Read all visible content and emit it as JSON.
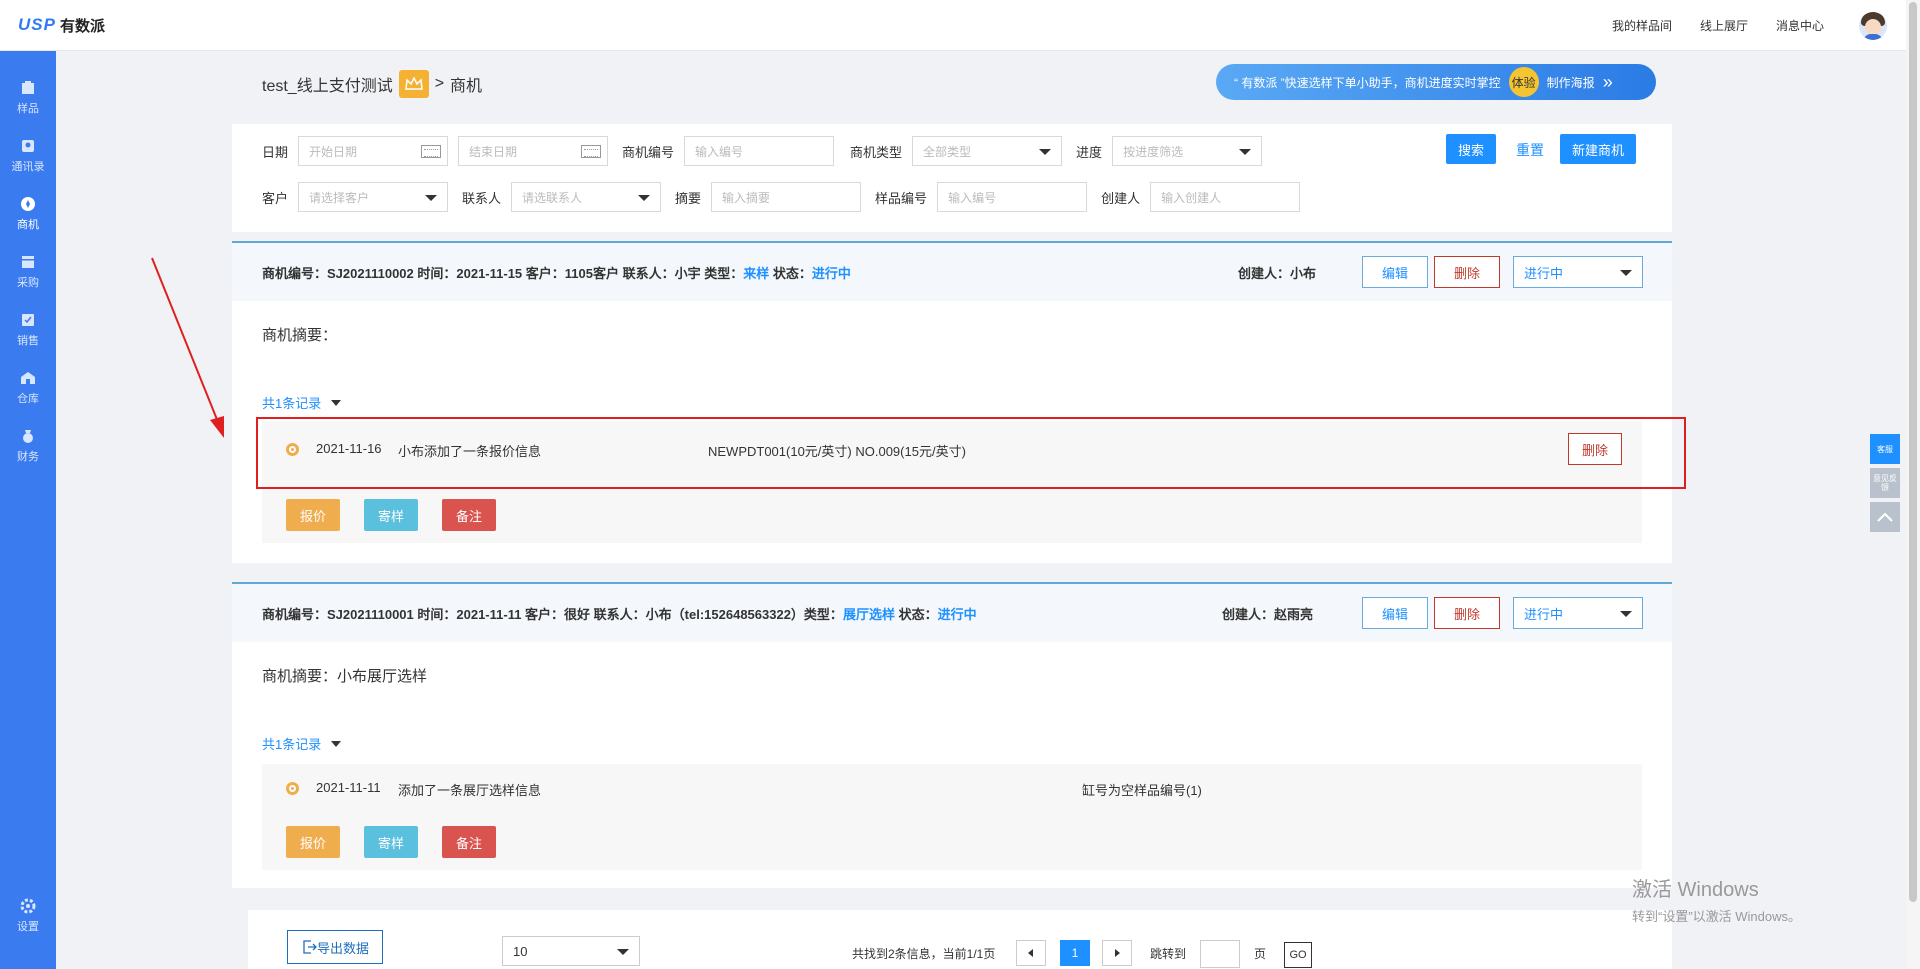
{
  "app": {
    "logo_mark": "USP",
    "logo_name": "有数派"
  },
  "topnav": [
    "我的样品间",
    "线上展厅",
    "消息中心"
  ],
  "sidebar": {
    "items": [
      {
        "label": "样品",
        "icon": "sample-icon"
      },
      {
        "label": "通讯录",
        "icon": "contacts-icon"
      },
      {
        "label": "商机",
        "icon": "opportunity-icon",
        "active": true
      },
      {
        "label": "采购",
        "icon": "purchase-icon"
      },
      {
        "label": "销售",
        "icon": "sales-icon"
      },
      {
        "label": "仓库",
        "icon": "warehouse-icon"
      },
      {
        "label": "财务",
        "icon": "finance-icon"
      }
    ],
    "settings_label": "设置"
  },
  "breadcrumb": {
    "shop": "test_线上支付测试",
    "sep": ">",
    "current": "商机"
  },
  "banner": {
    "text": "“ 有数派 ”快速选样下单小助手，商机进度实时掌控",
    "badge": "体验",
    "action": "制作海报"
  },
  "filters": {
    "date_label": "日期",
    "start_placeholder": "开始日期",
    "end_placeholder": "结束日期",
    "code_label": "商机编号",
    "code_placeholder": "输入编号",
    "type_label": "商机类型",
    "type_placeholder": "全部类型",
    "progress_label": "进度",
    "progress_placeholder": "按进度筛选",
    "customer_label": "客户",
    "customer_placeholder": "请选择客户",
    "contact_label": "联系人",
    "contact_placeholder": "请选联系人",
    "summary_label": "摘要",
    "summary_placeholder": "输入摘要",
    "sample_label": "样品编号",
    "sample_placeholder": "输入编号",
    "creator_label": "创建人",
    "creator_placeholder": "输入创建人",
    "search": "搜索",
    "reset": "重置",
    "new": "新建商机"
  },
  "cards": [
    {
      "info_prefix": "商机编号：SJ2021110002  时间：2021-11-15  客户：1105客户  联系人：小宇  类型：",
      "type": "来样",
      "status_label": " 状态：",
      "status": "进行中",
      "creator": "创建人：小布",
      "edit": "编辑",
      "delete": "删除",
      "progress": "进行中",
      "summary": "商机摘要：",
      "records": "共1条记录",
      "log": {
        "date": "2021-11-16",
        "desc": "小布添加了一条报价信息",
        "detail": "NEWPDT001(10元/英寸) NO.009(15元/英寸)",
        "delete": "删除"
      },
      "actions": [
        "报价",
        "寄样",
        "备注"
      ]
    },
    {
      "info_prefix": "商机编号：SJ2021110001  时间：2021-11-11  客户：很好  联系人：小布（tel:152648563322）类型：",
      "type": "展厅选样",
      "status_label": " 状态：",
      "status": "进行中",
      "creator": "创建人：赵雨亮",
      "edit": "编辑",
      "delete": "删除",
      "progress": "进行中",
      "summary": "商机摘要：小布展厅选样",
      "records": "共1条记录",
      "log": {
        "date": "2021-11-11",
        "desc": "添加了一条展厅选样信息",
        "detail": "缸号为空样品编号(1)"
      },
      "actions": [
        "报价",
        "寄样",
        "备注"
      ]
    }
  ],
  "pagination": {
    "export": "导出数据",
    "page_size": "10",
    "info": "共找到2条信息，当前1/1页",
    "current_page": "1",
    "jump_label": "跳转到",
    "page_unit": "页",
    "go": "GO"
  },
  "float_tools": [
    "客服",
    "意见反馈"
  ],
  "watermark": {
    "line1": "激活 Windows",
    "line2": "转到“设置”以激活 Windows。"
  },
  "colors": {
    "sidebar": "#3a7cf0",
    "primary": "#1e90ff",
    "danger": "#d9534f",
    "warning": "#f0ad4e",
    "info": "#5bc0de",
    "highlight_box": "#e02020"
  }
}
